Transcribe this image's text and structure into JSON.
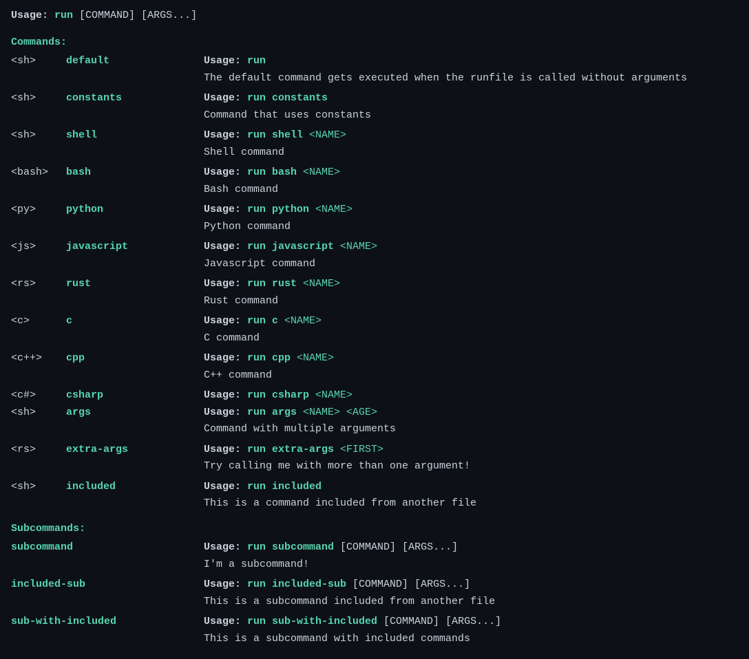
{
  "usage": {
    "label": "Usage:",
    "command": "run",
    "args": "[COMMAND] [ARGS...]"
  },
  "sections": {
    "commands_label": "Commands:",
    "subcommands_label": "Subcommands:"
  },
  "commands": [
    {
      "type": "<sh>",
      "name": "default",
      "usage_label": "Usage:",
      "usage_cmd": "run",
      "usage_args": "",
      "description": "The default command gets executed when the runfile is called without arguments"
    },
    {
      "type": "<sh>",
      "name": "constants",
      "usage_label": "Usage:",
      "usage_cmd": "run constants",
      "usage_args": "",
      "description": "Command that uses constants"
    },
    {
      "type": "<sh>",
      "name": "shell",
      "usage_label": "Usage:",
      "usage_cmd": "run shell",
      "usage_args": "<NAME>",
      "description": "Shell command"
    },
    {
      "type": "<bash>",
      "name": "bash",
      "usage_label": "Usage:",
      "usage_cmd": "run bash",
      "usage_args": "<NAME>",
      "description": "Bash command"
    },
    {
      "type": "<py>",
      "name": "python",
      "usage_label": "Usage:",
      "usage_cmd": "run python",
      "usage_args": "<NAME>",
      "description": "Python command"
    },
    {
      "type": "<js>",
      "name": "javascript",
      "usage_label": "Usage:",
      "usage_cmd": "run javascript",
      "usage_args": "<NAME>",
      "description": "Javascript command"
    },
    {
      "type": "<rs>",
      "name": "rust",
      "usage_label": "Usage:",
      "usage_cmd": "run rust",
      "usage_args": "<NAME>",
      "description": "Rust command"
    },
    {
      "type": "<c>",
      "name": "c",
      "usage_label": "Usage:",
      "usage_cmd": "run c",
      "usage_args": "<NAME>",
      "description": "C command"
    },
    {
      "type": "<c++>",
      "name": "cpp",
      "usage_label": "Usage:",
      "usage_cmd": "run cpp",
      "usage_args": "<NAME>",
      "description": "C++ command"
    },
    {
      "type": "<c#>",
      "name": "csharp",
      "usage_label": "Usage:",
      "usage_cmd": "run csharp",
      "usage_args": "<NAME>",
      "description": ""
    },
    {
      "type": "<sh>",
      "name": "args",
      "usage_label": "Usage:",
      "usage_cmd": "run args",
      "usage_args": "<NAME> <AGE>",
      "description": "Command with multiple arguments"
    },
    {
      "type": "<rs>",
      "name": "extra-args",
      "usage_label": "Usage:",
      "usage_cmd": "run extra-args",
      "usage_args": "<FIRST>",
      "description": "Try calling me with more than one argument!"
    },
    {
      "type": "<sh>",
      "name": "included",
      "usage_label": "Usage:",
      "usage_cmd": "run included",
      "usage_args": "",
      "description": "This is a command included from another file"
    }
  ],
  "subcommands": [
    {
      "name": "subcommand",
      "usage_label": "Usage:",
      "usage_cmd": "run subcommand",
      "usage_args": "[COMMAND] [ARGS...]",
      "description": "I'm a subcommand!"
    },
    {
      "name": "included-sub",
      "usage_label": "Usage:",
      "usage_cmd": "run included-sub",
      "usage_args": "[COMMAND] [ARGS...]",
      "description": "This is a subcommand included from another file"
    },
    {
      "name": "sub-with-included",
      "usage_label": "Usage:",
      "usage_cmd": "run sub-with-included",
      "usage_args": "[COMMAND] [ARGS...]",
      "description": "This is a subcommand with included commands"
    }
  ]
}
